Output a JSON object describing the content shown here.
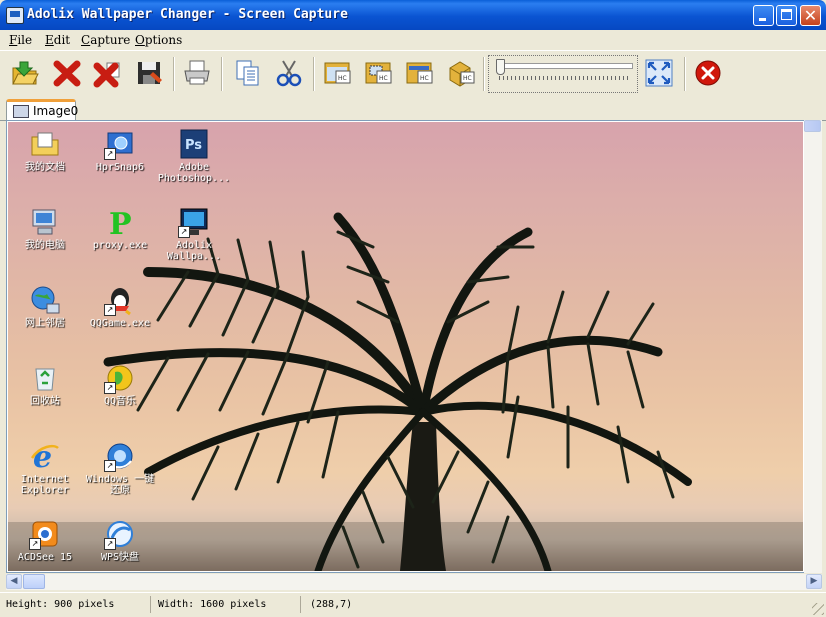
{
  "window": {
    "title": "Adolix Wallpaper Changer - Screen Capture"
  },
  "menu": [
    {
      "mnemonic": "F",
      "rest": "ile"
    },
    {
      "mnemonic": "E",
      "rest": "dit"
    },
    {
      "mnemonic": "C",
      "rest": "apture"
    },
    {
      "mnemonic": "O",
      "rest": "ptions"
    }
  ],
  "toolbar": {
    "icons": [
      "open-folder-icon",
      "delete-icon",
      "delete-all-icon",
      "save-icon",
      "print-icon",
      "copy-icon",
      "cut-icon",
      "capture-window-icon",
      "capture-region-icon",
      "capture-object-icon",
      "capture-scroll-icon",
      "fit-screen-icon",
      "exit-icon"
    ],
    "slider_level": 0
  },
  "tab": {
    "label": "Image0"
  },
  "desktop_icons": [
    {
      "label": "我的文档",
      "icon": "my-documents-icon"
    },
    {
      "label": "HprSnap6",
      "icon": "hypersnap-icon"
    },
    {
      "label": "Adobe\nPhotoshop...",
      "icon": "photoshop-icon"
    },
    {
      "label": "我的电脑",
      "icon": "my-computer-icon"
    },
    {
      "label": "proxy.exe",
      "icon": "proxy-icon"
    },
    {
      "label": "Adolix\nWallpa...",
      "icon": "adolix-icon"
    },
    {
      "label": "网上邻居",
      "icon": "network-places-icon"
    },
    {
      "label": "QQGame.exe",
      "icon": "qqgame-icon"
    },
    {
      "label": "回收站",
      "icon": "recycle-bin-icon"
    },
    {
      "label": "QQ音乐",
      "icon": "qq-music-icon"
    },
    {
      "label": "Internet\nExplorer",
      "icon": "internet-explorer-icon"
    },
    {
      "label": "Windows 一键\n还原",
      "icon": "windows-restore-icon"
    },
    {
      "label": "ACDSee 15",
      "icon": "acdsee-icon"
    },
    {
      "label": "WPS快盘",
      "icon": "wps-icon"
    }
  ],
  "status": {
    "height": "Height: 900 pixels",
    "width": "Width: 1600 pixels",
    "coords": "(288,7)"
  },
  "colors": {
    "titlebar": "#0a54d2",
    "close_button": "#c5421c",
    "accent_tab": "#f0a03a"
  }
}
